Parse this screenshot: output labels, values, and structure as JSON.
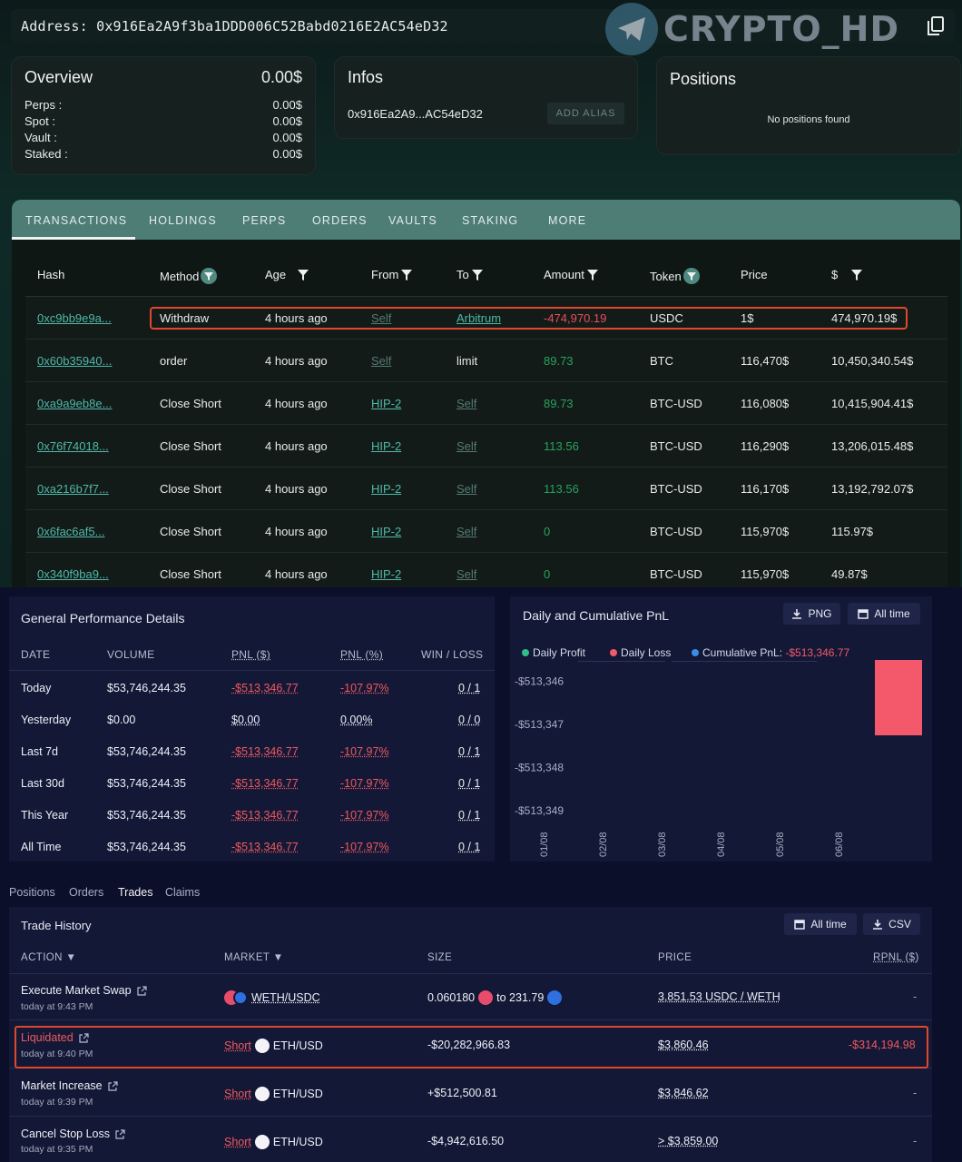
{
  "address_bar": {
    "label": "Address:",
    "address": "0x916Ea2A9f3ba1DDD006C52Babd0216E2AC54eD32"
  },
  "watermark": {
    "text": "CRYPTO_HD"
  },
  "overview": {
    "title": "Overview",
    "total": "0.00$",
    "rows": [
      {
        "label": "Perps :",
        "value": "0.00$"
      },
      {
        "label": "Spot :",
        "value": "0.00$"
      },
      {
        "label": "Vault :",
        "value": "0.00$"
      },
      {
        "label": "Staked :",
        "value": "0.00$"
      }
    ]
  },
  "infos": {
    "title": "Infos",
    "short_address": "0x916Ea2A9...AC54eD32",
    "alias_button": "ADD ALIAS"
  },
  "positions_card": {
    "title": "Positions",
    "empty": "No positions found"
  },
  "tabs": [
    "TRANSACTIONS",
    "HOLDINGS",
    "PERPS",
    "ORDERS",
    "VAULTS",
    "STAKING",
    "MORE"
  ],
  "tx_table": {
    "headers": [
      "Hash",
      "Method",
      "Age",
      "From",
      "To",
      "Amount",
      "Token",
      "Price",
      "$"
    ],
    "rows": [
      {
        "hash": "0xc9bb9e9a...",
        "method": "Withdraw",
        "age": "4 hours ago",
        "from": "Self",
        "to": "Arbitrum",
        "amount": "-474,970.19",
        "token": "USDC",
        "price": "1$",
        "usd": "474,970.19$"
      },
      {
        "hash": "0x60b35940...",
        "method": "order",
        "age": "4 hours ago",
        "from": "Self",
        "to": "limit",
        "amount": "89.73",
        "token": "BTC",
        "price": "116,470$",
        "usd": "10,450,340.54$"
      },
      {
        "hash": "0xa9a9eb8e...",
        "method": "Close Short",
        "age": "4 hours ago",
        "from": "HIP-2",
        "to": "Self",
        "amount": "89.73",
        "token": "BTC-USD",
        "price": "116,080$",
        "usd": "10,415,904.41$"
      },
      {
        "hash": "0x76f74018...",
        "method": "Close Short",
        "age": "4 hours ago",
        "from": "HIP-2",
        "to": "Self",
        "amount": "113.56",
        "token": "BTC-USD",
        "price": "116,290$",
        "usd": "13,206,015.48$"
      },
      {
        "hash": "0xa216b7f7...",
        "method": "Close Short",
        "age": "4 hours ago",
        "from": "HIP-2",
        "to": "Self",
        "amount": "113.56",
        "token": "BTC-USD",
        "price": "116,170$",
        "usd": "13,192,792.07$"
      },
      {
        "hash": "0x6fac6af5...",
        "method": "Close Short",
        "age": "4 hours ago",
        "from": "HIP-2",
        "to": "Self",
        "amount": "0",
        "token": "BTC-USD",
        "price": "115,970$",
        "usd": "115.97$"
      },
      {
        "hash": "0x340f9ba9...",
        "method": "Close Short",
        "age": "4 hours ago",
        "from": "HIP-2",
        "to": "Self",
        "amount": "0",
        "token": "BTC-USD",
        "price": "115,970$",
        "usd": "49.87$"
      }
    ]
  },
  "performance": {
    "title": "General Performance Details",
    "headers": [
      "DATE",
      "VOLUME",
      "PNL ($)",
      "PNL (%)",
      "WIN / LOSS"
    ],
    "rows": [
      {
        "date": "Today",
        "volume": "$53,746,244.35",
        "pnl": "-$513,346.77",
        "pnl_pct": "-107.97%",
        "wl": "0 / 1"
      },
      {
        "date": "Yesterday",
        "volume": "$0.00",
        "pnl": "$0.00",
        "pnl_pct": "0.00%",
        "wl": "0 / 0"
      },
      {
        "date": "Last 7d",
        "volume": "$53,746,244.35",
        "pnl": "-$513,346.77",
        "pnl_pct": "-107.97%",
        "wl": "0 / 1"
      },
      {
        "date": "Last 30d",
        "volume": "$53,746,244.35",
        "pnl": "-$513,346.77",
        "pnl_pct": "-107.97%",
        "wl": "0 / 1"
      },
      {
        "date": "This Year",
        "volume": "$53,746,244.35",
        "pnl": "-$513,346.77",
        "pnl_pct": "-107.97%",
        "wl": "0 / 1"
      },
      {
        "date": "All Time",
        "volume": "$53,746,244.35",
        "pnl": "-$513,346.77",
        "pnl_pct": "-107.97%",
        "wl": "0 / 1"
      }
    ]
  },
  "pnl_chart": {
    "title": "Daily and Cumulative PnL",
    "png_button": "PNG",
    "range_button": "All time",
    "legend": {
      "profit": "Daily Profit",
      "loss": "Daily Loss",
      "cumulative_label": "Cumulative PnL:",
      "cumulative_value": "-$513,346.77"
    },
    "colors": {
      "profit": "#2ec08c",
      "loss": "#f3596a",
      "cumulative": "#3a8de8"
    }
  },
  "chart_data": {
    "type": "bar",
    "title": "Daily and Cumulative PnL",
    "categories": [
      "01/08",
      "02/08",
      "03/08",
      "04/08",
      "05/08",
      "06/08"
    ],
    "y_ticks": [
      "-$513,346",
      "-$513,347",
      "-$513,348",
      "-$513,349"
    ],
    "ylim": [
      -513349.4,
      -513345.5
    ],
    "series": [
      {
        "name": "Daily Loss",
        "bar_top": -513345.5,
        "bar_bottom": -513347.25,
        "position": "right-edge"
      }
    ]
  },
  "subtabs": [
    "Positions",
    "Orders",
    "Trades",
    "Claims"
  ],
  "trade_history": {
    "title": "Trade History",
    "range_button": "All time",
    "csv_button": "CSV",
    "headers": [
      "ACTION",
      "MARKET",
      "SIZE",
      "PRICE",
      "RPNL ($)"
    ],
    "rows": [
      {
        "action": "Execute Market Swap",
        "time": "today at 9:43 PM",
        "side": "",
        "market": "WETH/USDC",
        "size_a": "0.060180",
        "size_b": "to 231.79",
        "price": "3,851.53 USDC / WETH",
        "rpnl": "-"
      },
      {
        "action": "Liquidated",
        "time": "today at 9:40 PM",
        "side": "Short",
        "market": "ETH/USD",
        "size_a": "-$20,282,966.83",
        "size_b": "",
        "price": "$3,860.46",
        "rpnl": "-$314,194.98"
      },
      {
        "action": "Market Increase",
        "time": "today at 9:39 PM",
        "side": "Short",
        "market": "ETH/USD",
        "size_a": "+$512,500.81",
        "size_b": "",
        "price": "$3,846.62",
        "rpnl": "-"
      },
      {
        "action": "Cancel Stop Loss",
        "time": "today at 9:35 PM",
        "side": "Short",
        "market": "ETH/USD",
        "size_a": "-$4,942,616.50",
        "size_b": "",
        "price": "> $3,859.00",
        "rpnl": "-"
      }
    ]
  }
}
